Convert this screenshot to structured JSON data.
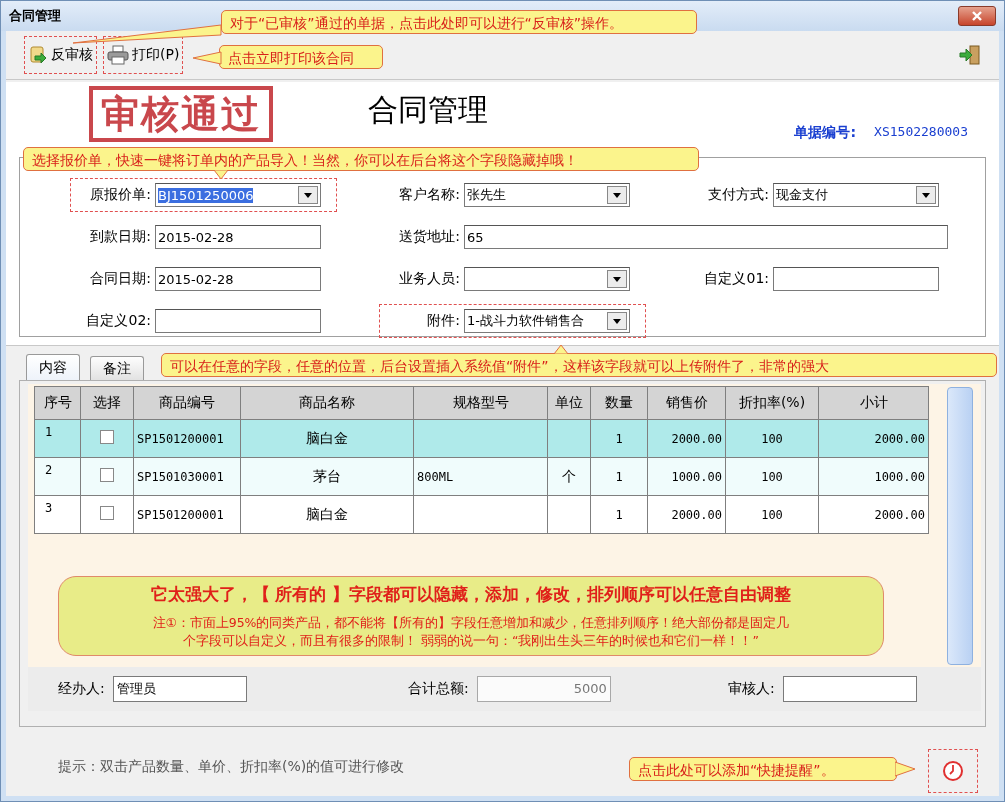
{
  "window": {
    "title": "合同管理"
  },
  "toolbar": [
    {
      "label": "反审核",
      "kind": "unaudit",
      "outlined": true
    },
    {
      "label": "打印(P)",
      "kind": "print",
      "outlined": true
    }
  ],
  "stamp": "审核通过",
  "form_title": "合同管理",
  "document_number": {
    "label": "单据编号:",
    "value": "XS1502280003"
  },
  "fields": [
    {
      "label": "原报价单:",
      "value": "BJ1501250006",
      "kind": "dropdown",
      "highlighted": true,
      "outlined": true
    },
    {
      "label": "客户名称:",
      "value": "张先生",
      "kind": "dropdown",
      "highlighted": false,
      "outlined": false
    },
    {
      "label": "支付方式:",
      "value": "现金支付",
      "kind": "dropdown",
      "highlighted": false,
      "outlined": false
    },
    {
      "label": "到款日期:",
      "value": "2015-02-28",
      "kind": "text",
      "highlighted": false,
      "outlined": false
    },
    {
      "label": "送货地址:",
      "value": "65",
      "kind": "wide_text",
      "highlighted": false,
      "outlined": false
    },
    {
      "label": "合同日期:",
      "value": "2015-02-28",
      "kind": "text",
      "highlighted": false,
      "outlined": false
    },
    {
      "label": "业务人员:",
      "kind": "dropdown",
      "outlined": false
    },
    {
      "label": "自定义01:",
      "kind": "text",
      "outlined": false
    },
    {
      "label": "自定义02:",
      "kind": "text",
      "outlined": false
    },
    {
      "label": "附件:",
      "value": "1-战斗力软件销售合",
      "kind": "dropdown",
      "highlighted": false,
      "outlined": true
    }
  ],
  "tabs": [
    {
      "label": "内容",
      "selected": true
    },
    {
      "label": "备注",
      "selected": false
    }
  ],
  "table": {
    "columns": [
      "序号",
      "选择",
      "商品编号",
      "商品名称",
      "规格型号",
      "单位",
      "数量",
      "销售价",
      "折扣率(%)",
      "小计"
    ],
    "rows": [
      {
        "no": "1",
        "checked": false,
        "code": "SP1501200001",
        "name": "脑白金",
        "qty": "1",
        "price": "2000.00",
        "discount": "100",
        "subtotal": "2000.00",
        "selected": true
      },
      {
        "no": "2",
        "checked": false,
        "code": "SP1501030001",
        "name": "茅台",
        "spec": "800ML",
        "unit": "个",
        "qty": "1",
        "price": "1000.00",
        "discount": "100",
        "subtotal": "1000.00",
        "selected": false
      },
      {
        "no": "3",
        "checked": false,
        "code": "SP1501200001",
        "name": "脑白金",
        "qty": "1",
        "price": "2000.00",
        "discount": "100",
        "subtotal": "2000.00",
        "selected": false
      }
    ]
  },
  "notice": {
    "headline": "它太强大了，【 所有的 】字段都可以隐藏，添加，修改，排列顺序可以任意自由调整",
    "note_lines": [
      "注①：市面上95%的同类产品，都不能将【所有的】字段任意增加和减少，任意排列顺序！绝大部份都是固定几",
      "个字段可以自定义，而且有很多的限制！    弱弱的说一句：“我刚出生头三年的时候也和它们一样！！”"
    ]
  },
  "footer_fields": [
    {
      "label": "经办人:",
      "value": "管理员",
      "disabled": false
    },
    {
      "label": "合计总额:",
      "value": "5000",
      "disabled": true
    },
    {
      "label": "审核人:",
      "disabled": false
    }
  ],
  "hint": "提示：双击产品数量、单价、折扣率(%)的值可进行修改",
  "callouts": [
    {
      "text": "对于“已审核”通过的单据，点击此处即可以进行“反审核”操作。"
    },
    {
      "text": "点击立即打印该合同"
    },
    {
      "text": "选择报价单，快速一键将订单内的产品导入！当然，你可以在后台将这个字段隐藏掉哦！"
    },
    {
      "text": "可以在任意的字段，任意的位置，后台设置插入系统值“附件”，这样该字段就可以上传附件了，非常的强大"
    },
    {
      "text": "点击此处可以添加“快捷提醒”。"
    }
  ]
}
